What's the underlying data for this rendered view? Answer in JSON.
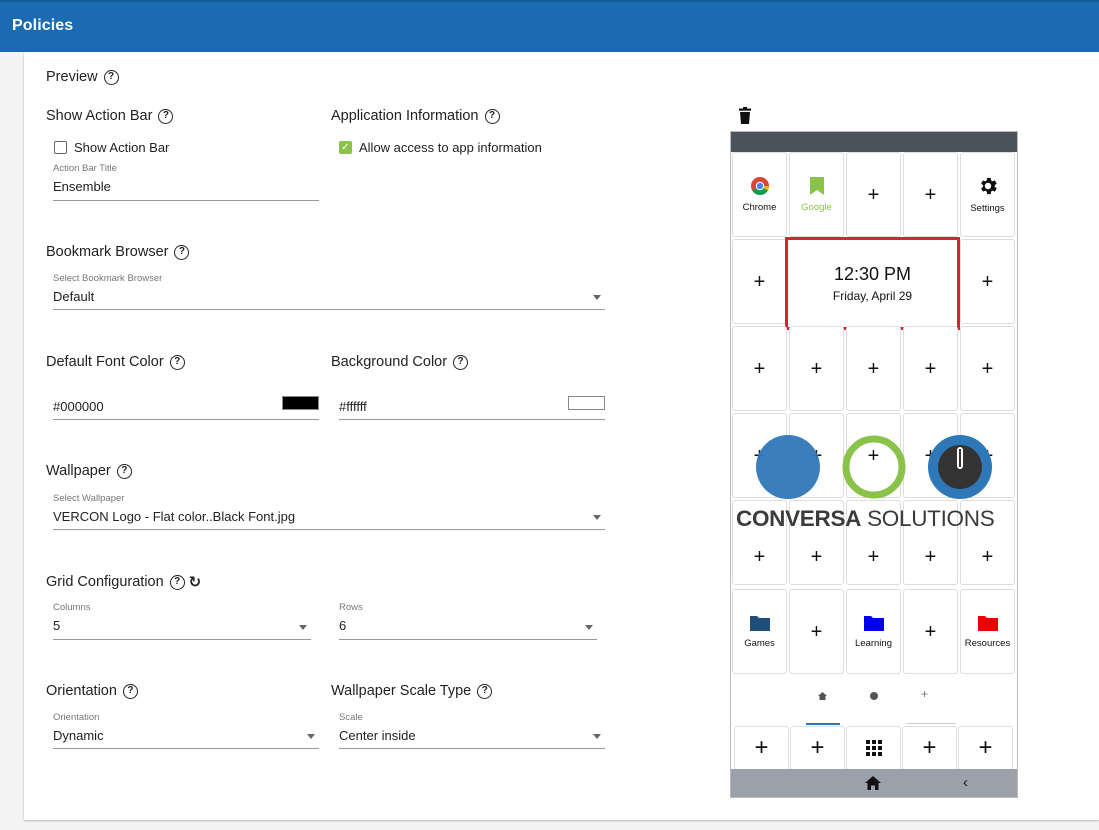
{
  "header": {
    "title": "Policies"
  },
  "preview": {
    "label": "Preview"
  },
  "action_bar": {
    "title": "Show Action Bar",
    "checkbox_label": "Show Action Bar",
    "checked": false,
    "title_field_label": "Action Bar Title",
    "title_field_value": "Ensemble"
  },
  "app_info": {
    "title": "Application Information",
    "checkbox_label": "Allow access to app information",
    "checked": true
  },
  "bookmark_browser": {
    "title": "Bookmark Browser",
    "field_label": "Select Bookmark Browser",
    "value": "Default"
  },
  "font_color": {
    "title": "Default Font Color",
    "value": "#000000",
    "swatch": "#000000"
  },
  "background_color": {
    "title": "Background Color",
    "value": "#ffffff",
    "swatch": "#ffffff"
  },
  "wallpaper": {
    "title": "Wallpaper",
    "field_label": "Select Wallpaper",
    "value": "VERCON Logo - Flat color..Black Font.jpg"
  },
  "grid": {
    "title": "Grid Configuration",
    "columns_label": "Columns",
    "columns_value": "5",
    "rows_label": "Rows",
    "rows_value": "6"
  },
  "orientation": {
    "title": "Orientation",
    "field_label": "Orientation",
    "value": "Dynamic"
  },
  "wallpaper_scale": {
    "title": "Wallpaper Scale Type",
    "field_label": "Scale",
    "value": "Center inside"
  },
  "phone": {
    "apps": {
      "chrome": "Chrome",
      "google": "Google",
      "settings": "Settings",
      "games": "Games",
      "learning": "Learning",
      "resources": "Resources"
    },
    "clock_time": "12:30 PM",
    "clock_date": "Friday, April 29",
    "logo_bold": "CONVERSA",
    "logo_light": " SOLUTIONS",
    "colors": {
      "google_green": "#8bc34a",
      "games_folder": "#1f4e79",
      "learning_folder": "#0000ee",
      "resources_folder": "#ee0000",
      "clock_border": "#e0202e",
      "status_bar": "#4a525c",
      "nav_bar": "#9aa1ab"
    }
  }
}
